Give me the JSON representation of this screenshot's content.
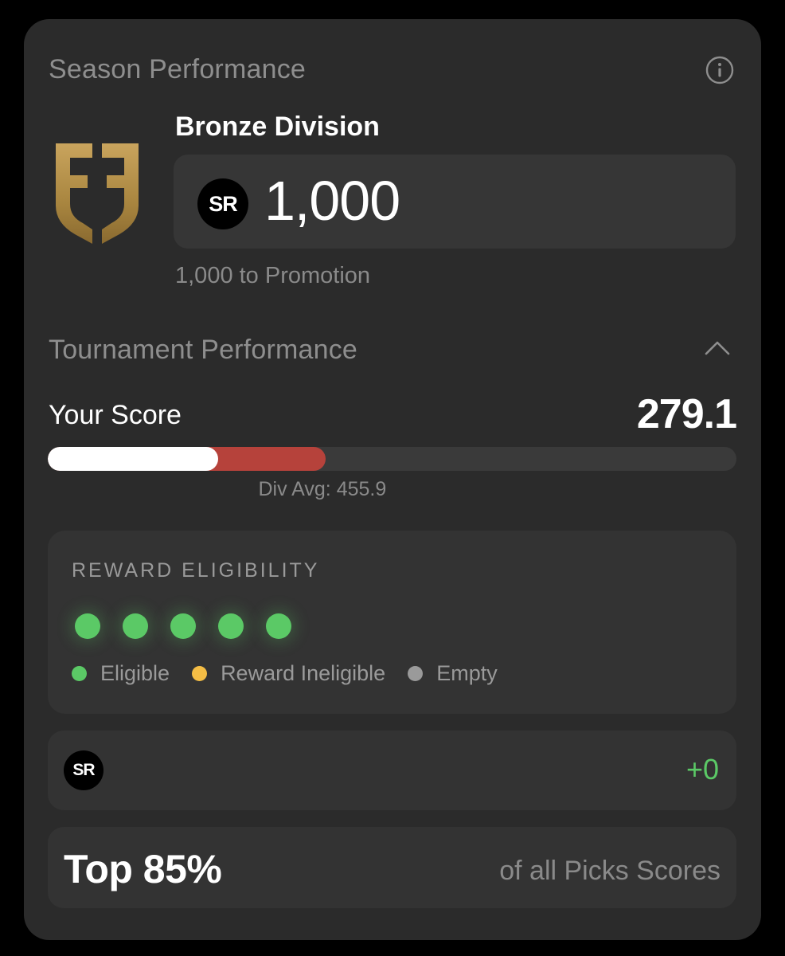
{
  "season": {
    "title": "Season Performance",
    "division": "Bronze Division",
    "sr_badge": "SR",
    "sr_value": "1,000",
    "promotion_text": "1,000 to Promotion"
  },
  "tournament": {
    "title": "Tournament Performance",
    "your_score_label": "Your Score",
    "score_value": "279.1",
    "score": 279.1,
    "div_avg": 455.9,
    "div_avg_text": "Div Avg: 455.9",
    "bar_scale_max": 1130
  },
  "reward": {
    "title": "REWARD ELIGIBILITY",
    "dots": [
      "eligible",
      "eligible",
      "eligible",
      "eligible",
      "eligible"
    ],
    "legend": [
      {
        "label": "Eligible",
        "color": "#5bc966"
      },
      {
        "label": "Reward Ineligible",
        "color": "#f4bd45"
      },
      {
        "label": "Empty",
        "color": "#9a9a9a"
      }
    ]
  },
  "sr_change": {
    "badge": "SR",
    "delta": "+0"
  },
  "rank": {
    "value": "Top 85%",
    "suffix": "of all Picks Scores"
  },
  "colors": {
    "accent_green": "#5bc966",
    "bar_red": "#b6423b",
    "logo_gold": "#b8944f"
  },
  "icons": {
    "info": "info-icon",
    "collapse": "chevron-up-icon",
    "logo": "division-shield-logo"
  }
}
